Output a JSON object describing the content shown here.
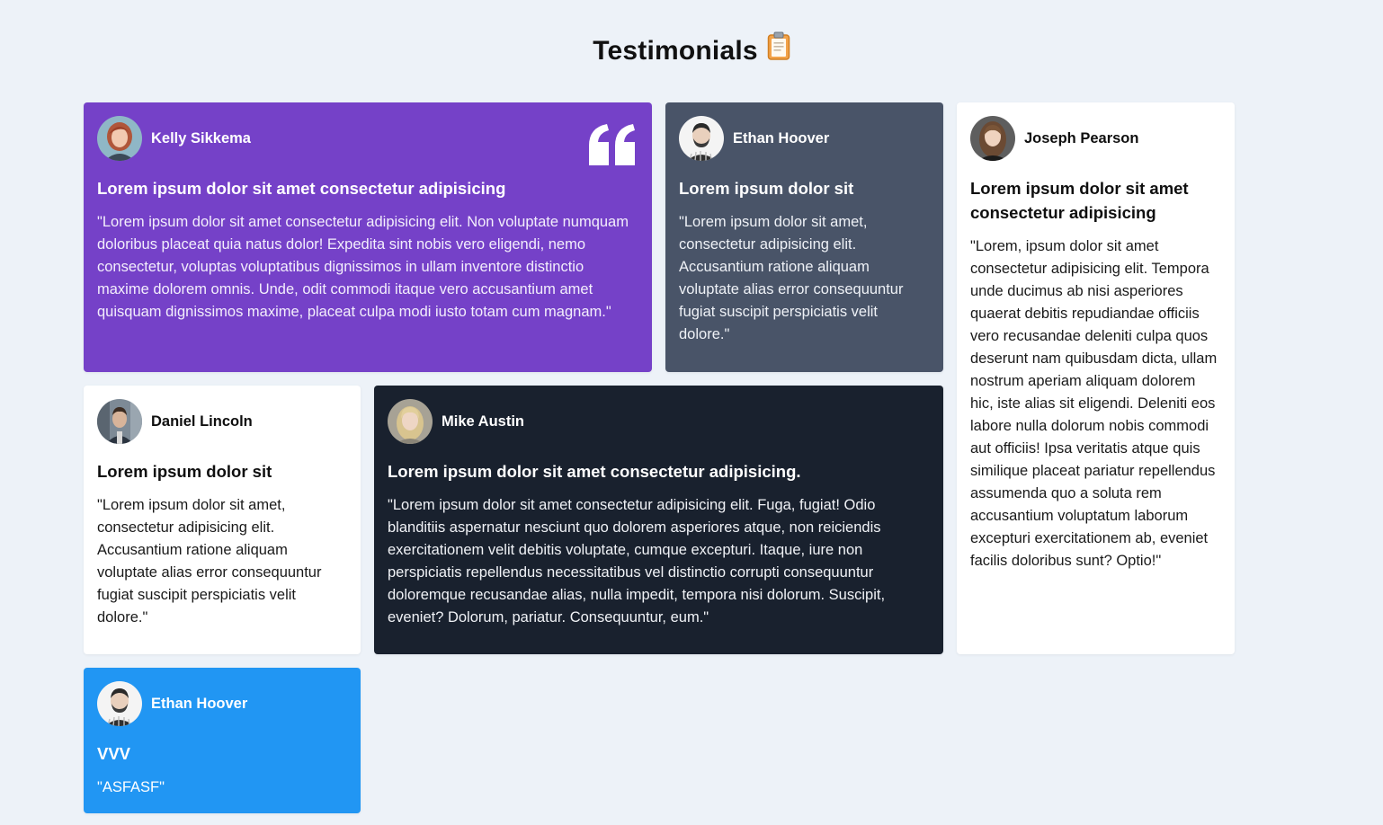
{
  "page": {
    "title": "Testimonials",
    "title_icon": "clipboard-icon"
  },
  "colors": {
    "background": "#edf2f8",
    "purple": "#7541c8",
    "slate": "#495468",
    "white": "#ffffff",
    "dark": "#19212e",
    "blue": "#2196f3"
  },
  "testimonials": [
    {
      "name": "Kelly Sikkema",
      "headline": "Lorem ipsum dolor sit amet consectetur adipisicing",
      "quote": "\"Lorem ipsum dolor sit amet consectetur adipisicing elit. Non voluptate numquam doloribus placeat quia natus dolor! Expedita sint nobis vero eligendi, nemo consectetur, voluptas voluptatibus dignissimos in ullam inventore distinctio maxime dolorem omnis. Unde, odit commodi itaque vero accusantium amet quisquam dignissimos maxime, placeat culpa modi iusto totam cum magnam.\"",
      "color": "purple",
      "icon": "quote-icon"
    },
    {
      "name": "Ethan Hoover",
      "headline": "Lorem ipsum dolor sit",
      "quote": "\"Lorem ipsum dolor sit amet, consectetur adipisicing elit. Accusantium ratione aliquam voluptate alias error consequuntur fugiat suscipit perspiciatis velit dolore.\"",
      "color": "slate"
    },
    {
      "name": "Joseph Pearson",
      "headline": "Lorem ipsum dolor sit amet consectetur adipisicing",
      "quote": "\"Lorem, ipsum dolor sit amet consectetur adipisicing elit. Tempora unde ducimus ab nisi asperiores quaerat debitis repudiandae officiis vero recusandae deleniti culpa quos deserunt nam quibusdam dicta, ullam nostrum aperiam aliquam dolorem hic, iste alias sit eligendi. Deleniti eos labore nulla dolorum nobis commodi aut officiis! Ipsa veritatis atque quis similique placeat pariatur repellendus assumenda quo a soluta rem accusantium voluptatum laborum excepturi exercitationem ab, eveniet facilis doloribus sunt? Optio!\"",
      "color": "white"
    },
    {
      "name": "Daniel Lincoln",
      "headline": "Lorem ipsum dolor sit",
      "quote": "\"Lorem ipsum dolor sit amet, consectetur adipisicing elit. Accusantium ratione aliquam voluptate alias error consequuntur fugiat suscipit perspiciatis velit dolore.\"",
      "color": "white"
    },
    {
      "name": "Mike Austin",
      "headline": "Lorem ipsum dolor sit amet consectetur adipisicing.",
      "quote": "\"Lorem ipsum dolor sit amet consectetur adipisicing elit. Fuga, fugiat! Odio blanditiis aspernatur nesciunt quo dolorem asperiores atque, non reiciendis exercitationem velit debitis voluptate, cumque excepturi. Itaque, iure non perspiciatis repellendus necessitatibus vel distinctio corrupti consequuntur doloremque recusandae alias, nulla impedit, tempora nisi dolorum. Suscipit, eveniet? Dolorum, pariatur. Consequuntur, eum.\"",
      "color": "dark"
    },
    {
      "name": "Ethan Hoover",
      "headline": "VVV",
      "quote": "\"ASFASF\"",
      "color": "blue"
    }
  ]
}
